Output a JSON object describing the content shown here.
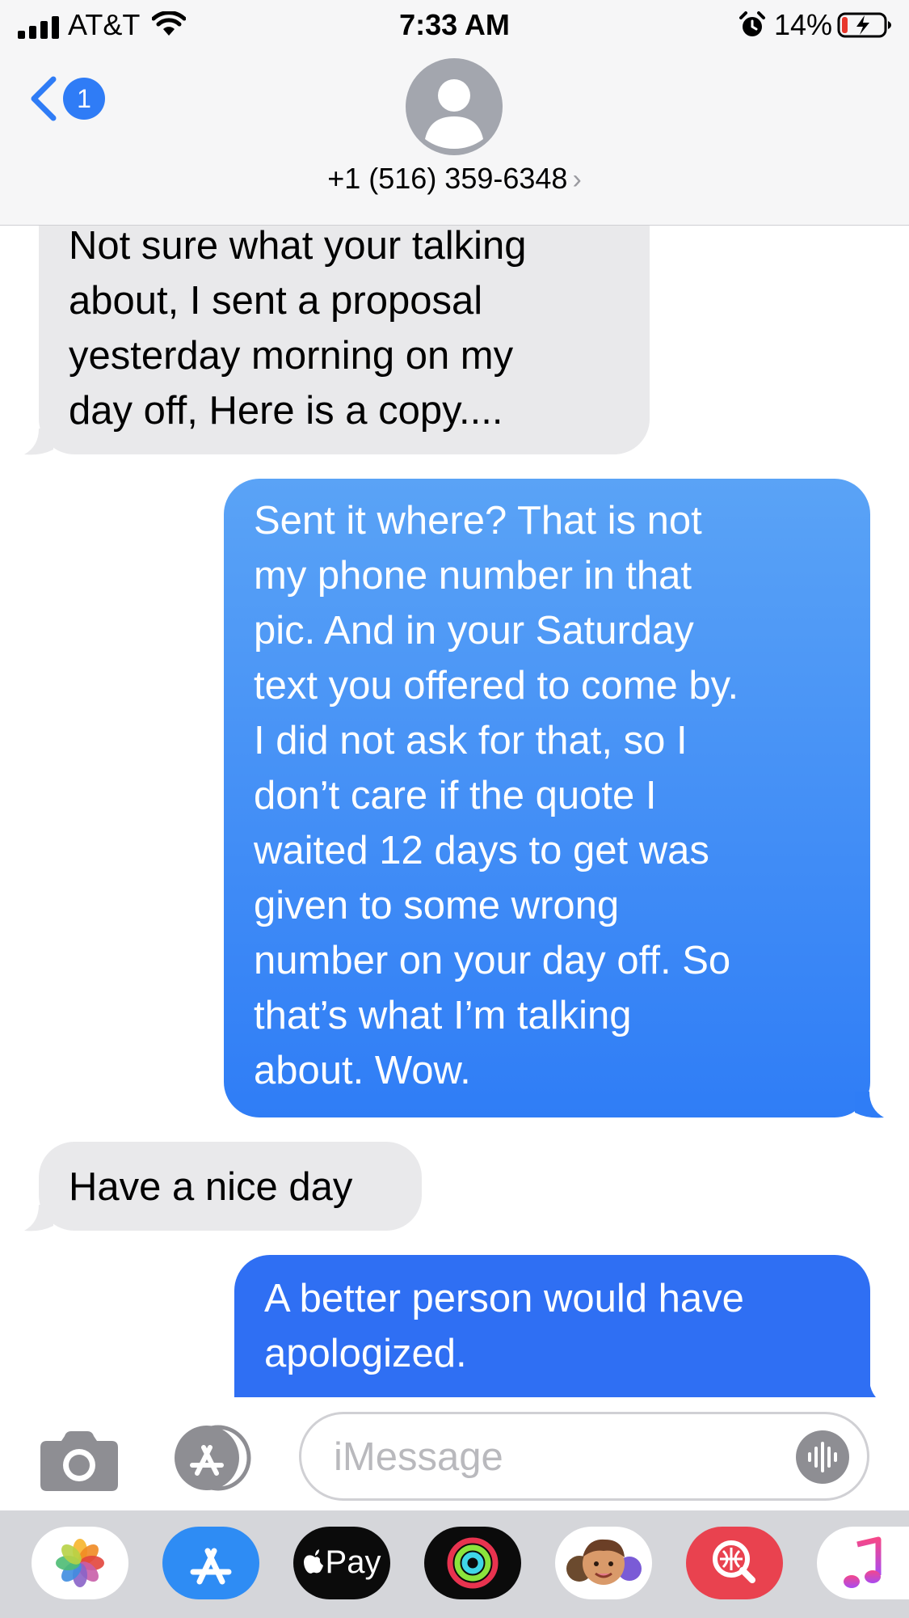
{
  "status_bar": {
    "carrier": "AT&T",
    "time": "7:33 AM",
    "battery_percent": "14%",
    "battery_level": 0.14
  },
  "header": {
    "back_badge_count": "1",
    "contact": "+1 (516) 359-6348",
    "contact_chevron": "›"
  },
  "messages": [
    {
      "direction": "incoming",
      "text": "Not sure what your talking\nabout, I sent a proposal\nyesterday morning on my\nday off, Here is a copy...."
    },
    {
      "direction": "outgoing",
      "text": "Sent it where? That is not\nmy phone number in that\npic. And in your Saturday\ntext you offered to come by.\nI did not ask for that, so I\ndon’t care if the quote I\nwaited 12 days to get was\ngiven to some wrong\nnumber on your day off. So\nthat’s what I’m talking\nabout.  Wow."
    },
    {
      "direction": "incoming",
      "text": "Have a nice day"
    },
    {
      "direction": "outgoing",
      "text": "A better person would have\napologized."
    }
  ],
  "compose": {
    "placeholder": "iMessage"
  },
  "app_drawer": {
    "apps": [
      "photos-icon",
      "app-store-icon",
      "apple-pay-icon",
      "activity-icon",
      "memoji-icon",
      "image-search-icon",
      "music-icon"
    ],
    "apple_pay_label": "Pay"
  },
  "colors": {
    "incoming_bubble": "#e9e9eb",
    "outgoing_bubble_top": "#5aa3f6",
    "outgoing_bubble_bottom": "#2f6ff3",
    "accent": "#2f7cf6",
    "battery_low": "#e8372c"
  }
}
